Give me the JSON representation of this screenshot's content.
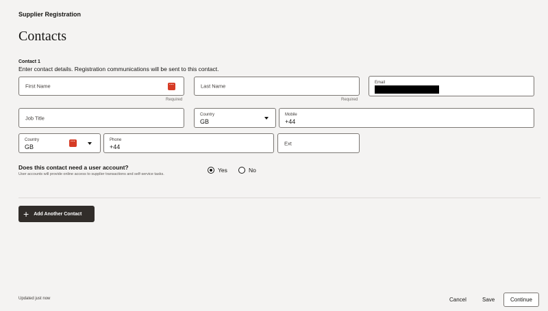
{
  "app_title": "Supplier Registration",
  "page_title": "Contacts",
  "contact": {
    "heading": "Contact 1",
    "description": "Enter contact details. Registration communications will be sent to this contact.",
    "first_name": {
      "placeholder": "First Name",
      "required": "Required"
    },
    "last_name": {
      "placeholder": "Last Name",
      "required": "Required"
    },
    "email": {
      "label": "Email"
    },
    "job_title": {
      "placeholder": "Job Title"
    },
    "mobile_country": {
      "label": "Country",
      "value": "GB"
    },
    "mobile": {
      "label": "Mobile",
      "value": "+44"
    },
    "phone_country": {
      "label": "Country",
      "value": "GB"
    },
    "phone": {
      "label": "Phone",
      "value": "+44"
    },
    "ext": {
      "placeholder": "Ext"
    }
  },
  "user_account": {
    "question": "Does this contact need a user account?",
    "help": "User accounts will provide online access to supplier transactions and self-service tasks.",
    "options": [
      "Yes",
      "No"
    ],
    "selected": "Yes"
  },
  "add_contact_label": "Add Another Contact",
  "footer": {
    "status": "Updated just now",
    "cancel": "Cancel",
    "save": "Save",
    "continue": "Continue"
  },
  "colors": {
    "error": "#d63b25",
    "dark_button": "#312d2a",
    "background": "#f4f3f2"
  }
}
